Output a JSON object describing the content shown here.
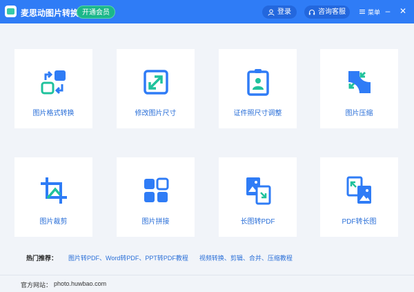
{
  "app": {
    "title": "麦思动图片转换器",
    "vip_label": "开通会员",
    "login_label": "登录",
    "support_label": "咨询客服",
    "menu_label": "菜单",
    "minimize_label": "–",
    "close_label": "✕"
  },
  "colors": {
    "titlebar": "#2f7cf6",
    "accent": "#2a6fd8",
    "vip": "#1bb78a"
  },
  "tools": [
    {
      "label": "图片格式转换",
      "icon": "format-convert-icon"
    },
    {
      "label": "修改图片尺寸",
      "icon": "resize-icon"
    },
    {
      "label": "证件照尺寸调整",
      "icon": "id-photo-icon"
    },
    {
      "label": "图片压缩",
      "icon": "compress-icon"
    },
    {
      "label": "图片裁剪",
      "icon": "crop-icon"
    },
    {
      "label": "图片拼接",
      "icon": "grid-join-icon"
    },
    {
      "label": "长图转PDF",
      "icon": "long-image-to-pdf-icon"
    },
    {
      "label": "PDF转长图",
      "icon": "pdf-to-long-image-icon"
    }
  ],
  "hot": {
    "label": "热门推荐：",
    "links": [
      "图片转PDF、Word转PDF、PPT转PDF教程",
      "视频转换、剪辑、合并、压缩教程"
    ]
  },
  "footer": {
    "label": "官方网站：",
    "url": "photo.huwbao.com"
  }
}
